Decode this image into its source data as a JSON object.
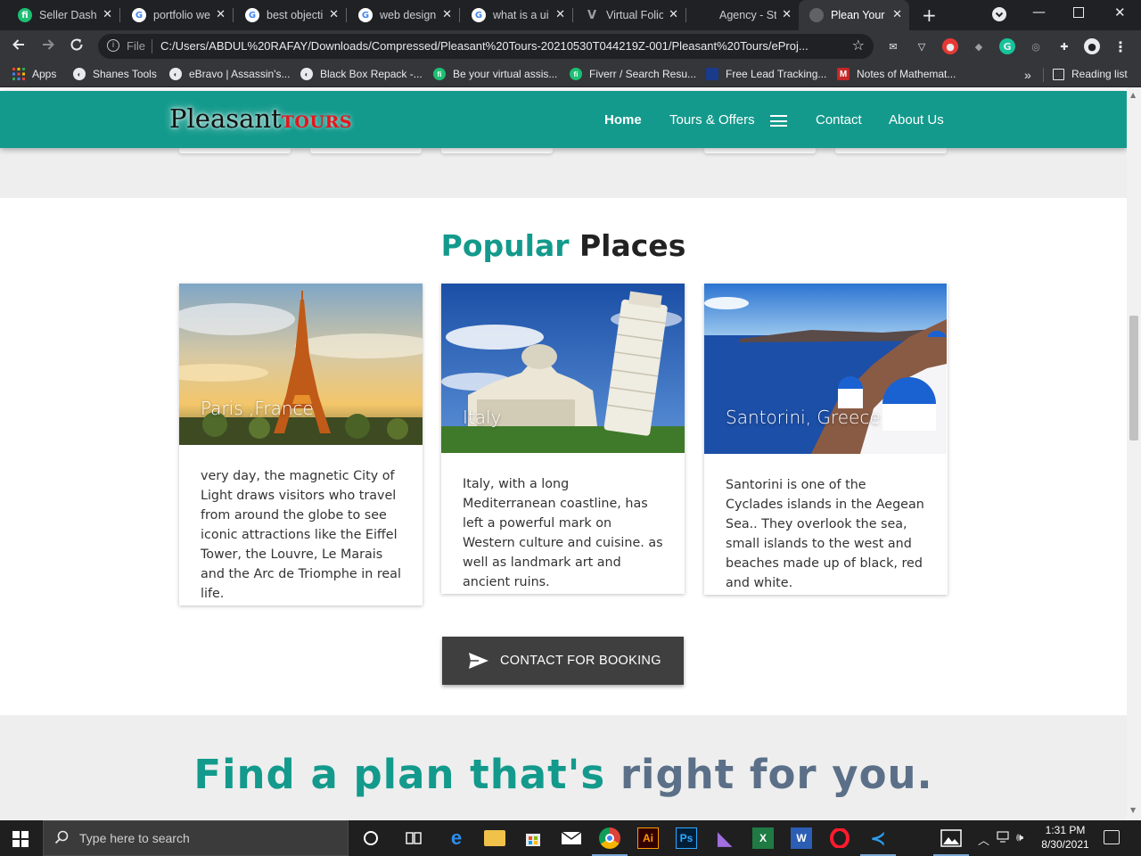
{
  "browser": {
    "tabs": [
      {
        "title": "Seller Dashb",
        "favicon": "fiverr-icon",
        "color": "#1dbf73"
      },
      {
        "title": "portfolio we",
        "favicon": "google-icon",
        "color": "#ffffff"
      },
      {
        "title": "best objecti",
        "favicon": "google-icon",
        "color": "#ffffff"
      },
      {
        "title": "web design",
        "favicon": "google-icon",
        "color": "#ffffff"
      },
      {
        "title": "what is a ui",
        "favicon": "google-icon",
        "color": "#ffffff"
      },
      {
        "title": "Virtual Folio",
        "favicon": "vf-icon",
        "color": "#9aa0a6"
      },
      {
        "title": "Agency - St",
        "favicon": "agency-icon",
        "color": "#202124"
      },
      {
        "title": "Plean Your",
        "favicon": "globe-icon",
        "color": "#9aa0a6"
      }
    ],
    "address": {
      "scheme_label": "File",
      "url": "C:/Users/ABDUL%20RAFAY/Downloads/Compressed/Pleasant%20Tours-20210530T044219Z-001/Pleasant%20Tours/eProj..."
    },
    "bookmarks": [
      {
        "label": "Apps",
        "icon": "apps-grid-icon"
      },
      {
        "label": "Shanes Tools",
        "icon": "globe-icon"
      },
      {
        "label": "eBravo | Assassin's...",
        "icon": "globe-icon"
      },
      {
        "label": "Black Box Repack -...",
        "icon": "globe-icon"
      },
      {
        "label": "Be your virtual assis...",
        "icon": "fiverr-icon"
      },
      {
        "label": "Fiverr / Search Resu...",
        "icon": "fiverr-icon"
      },
      {
        "label": "Free Lead Tracking...",
        "icon": "bookmark-icon"
      },
      {
        "label": "Notes of Mathemat...",
        "icon": "m-icon"
      }
    ],
    "bookmarks_overflow": "»",
    "reading_list": "Reading list"
  },
  "site": {
    "logo_main": "Pleasant",
    "logo_sub": "TOURS",
    "nav": [
      {
        "label": "Home",
        "active": true
      },
      {
        "label": "Tours & Offers",
        "active": false
      },
      {
        "label": "Contact",
        "active": false
      },
      {
        "label": "About Us",
        "active": false
      }
    ],
    "section_title_a": "Popular",
    "section_title_b": "Places",
    "cards": [
      {
        "caption": "Paris ,France",
        "body": "very day, the magnetic City of Light draws visitors who travel from around the globe to see iconic attractions like the Eiffel Tower, the Louvre, Le Marais and the Arc de Triomphe in real life."
      },
      {
        "caption": "Italy",
        "body": "Italy, with a long Mediterranean coastline, has left a powerful mark on Western culture and cuisine. as well as landmark art and ancient ruins."
      },
      {
        "caption": "Santorini, Greece",
        "body": "Santorini is one of the Cyclades islands in the Aegean Sea.. They overlook the sea, small islands to the west and beaches made up of black, red and white."
      }
    ],
    "cta_label": "CONTACT FOR BOOKING",
    "plans_title_a": "Find a plan that's",
    "plans_title_b": "right for you.",
    "colors": {
      "brand": "#139a8c",
      "accent_red": "#e8141c",
      "cta_bg": "#3f3f3f"
    }
  },
  "taskbar": {
    "search_placeholder": "Type here to search",
    "time": "1:31 PM",
    "date": "8/30/2021"
  }
}
